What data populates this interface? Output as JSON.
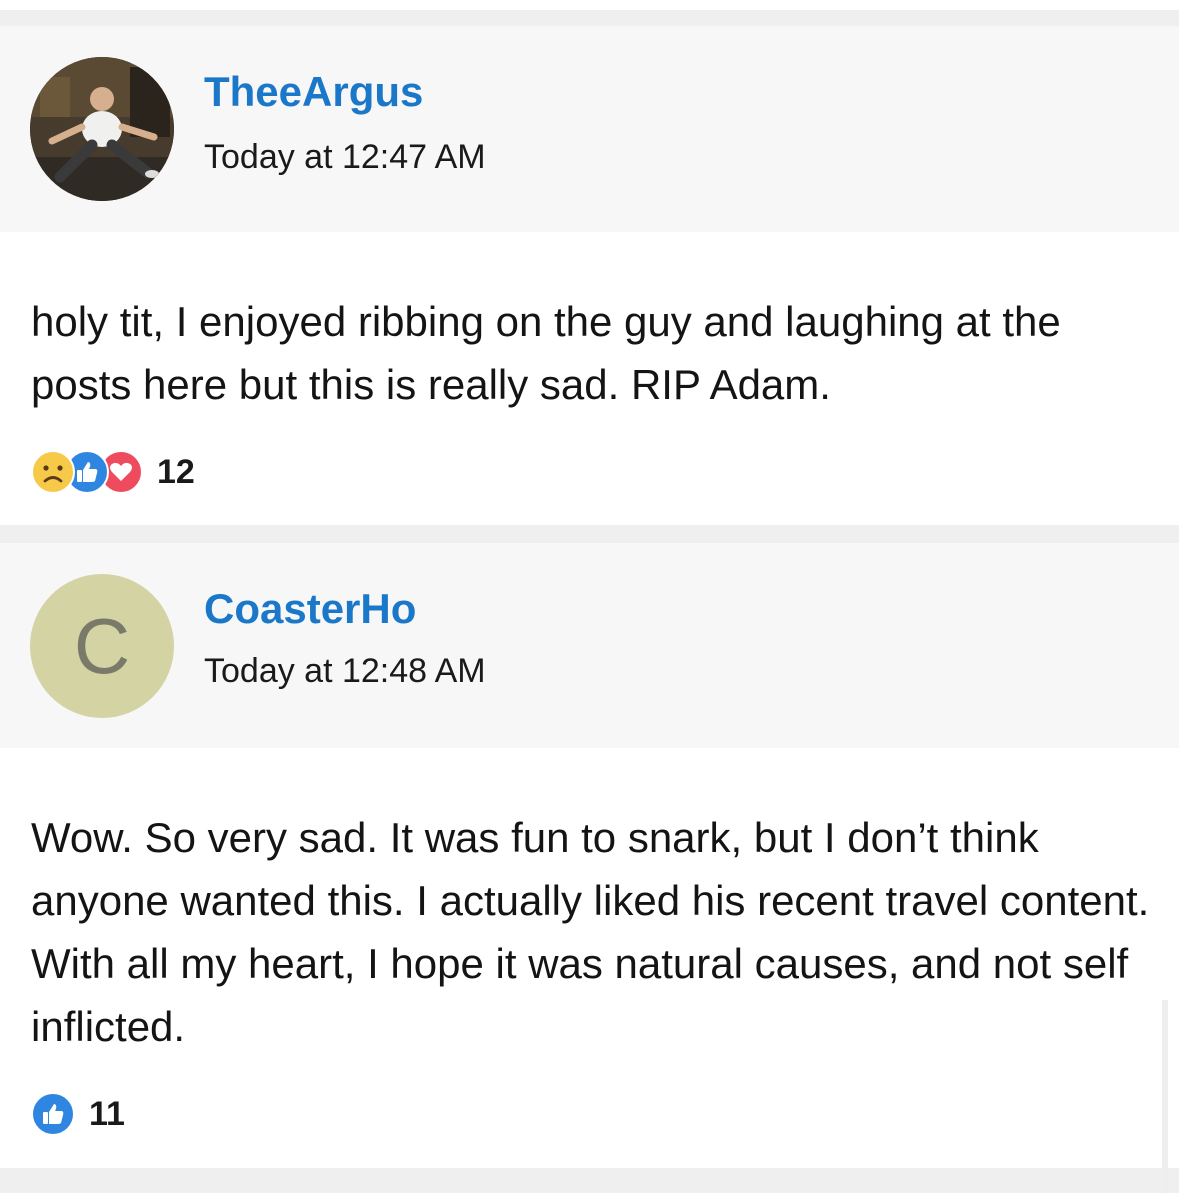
{
  "posts": [
    {
      "username": "TheeArgus",
      "timestamp": "Today at 12:47 AM",
      "body": "holy tit, I enjoyed ribbing on the guy and laughing at the posts here but this is really sad. RIP Adam.",
      "reaction_count": "12",
      "reaction_icons": [
        "sad-face-icon",
        "thumbs-up-icon",
        "heart-icon"
      ],
      "avatar": "photo-avatar"
    },
    {
      "username": "CoasterHo",
      "timestamp": "Today at 12:48 AM",
      "avatar_letter": "C",
      "body": "Wow. So very sad. It was fun to snark, but I don’t think anyone wanted this. I actually liked his recent travel content. With all my heart, I hope it was natural causes, and not self inflicted.",
      "reaction_count": "11",
      "reaction_icons": [
        "thumbs-up-icon"
      ]
    }
  ],
  "colors": {
    "username": "#1b78c9",
    "header_bg": "#f7f7f7",
    "separator": "#efefef",
    "letter_avatar_bg": "#d3d3a4",
    "like_blue": "#2f86e0",
    "love_red": "#ef4b5f",
    "sad_yellow": "#f7c948"
  }
}
